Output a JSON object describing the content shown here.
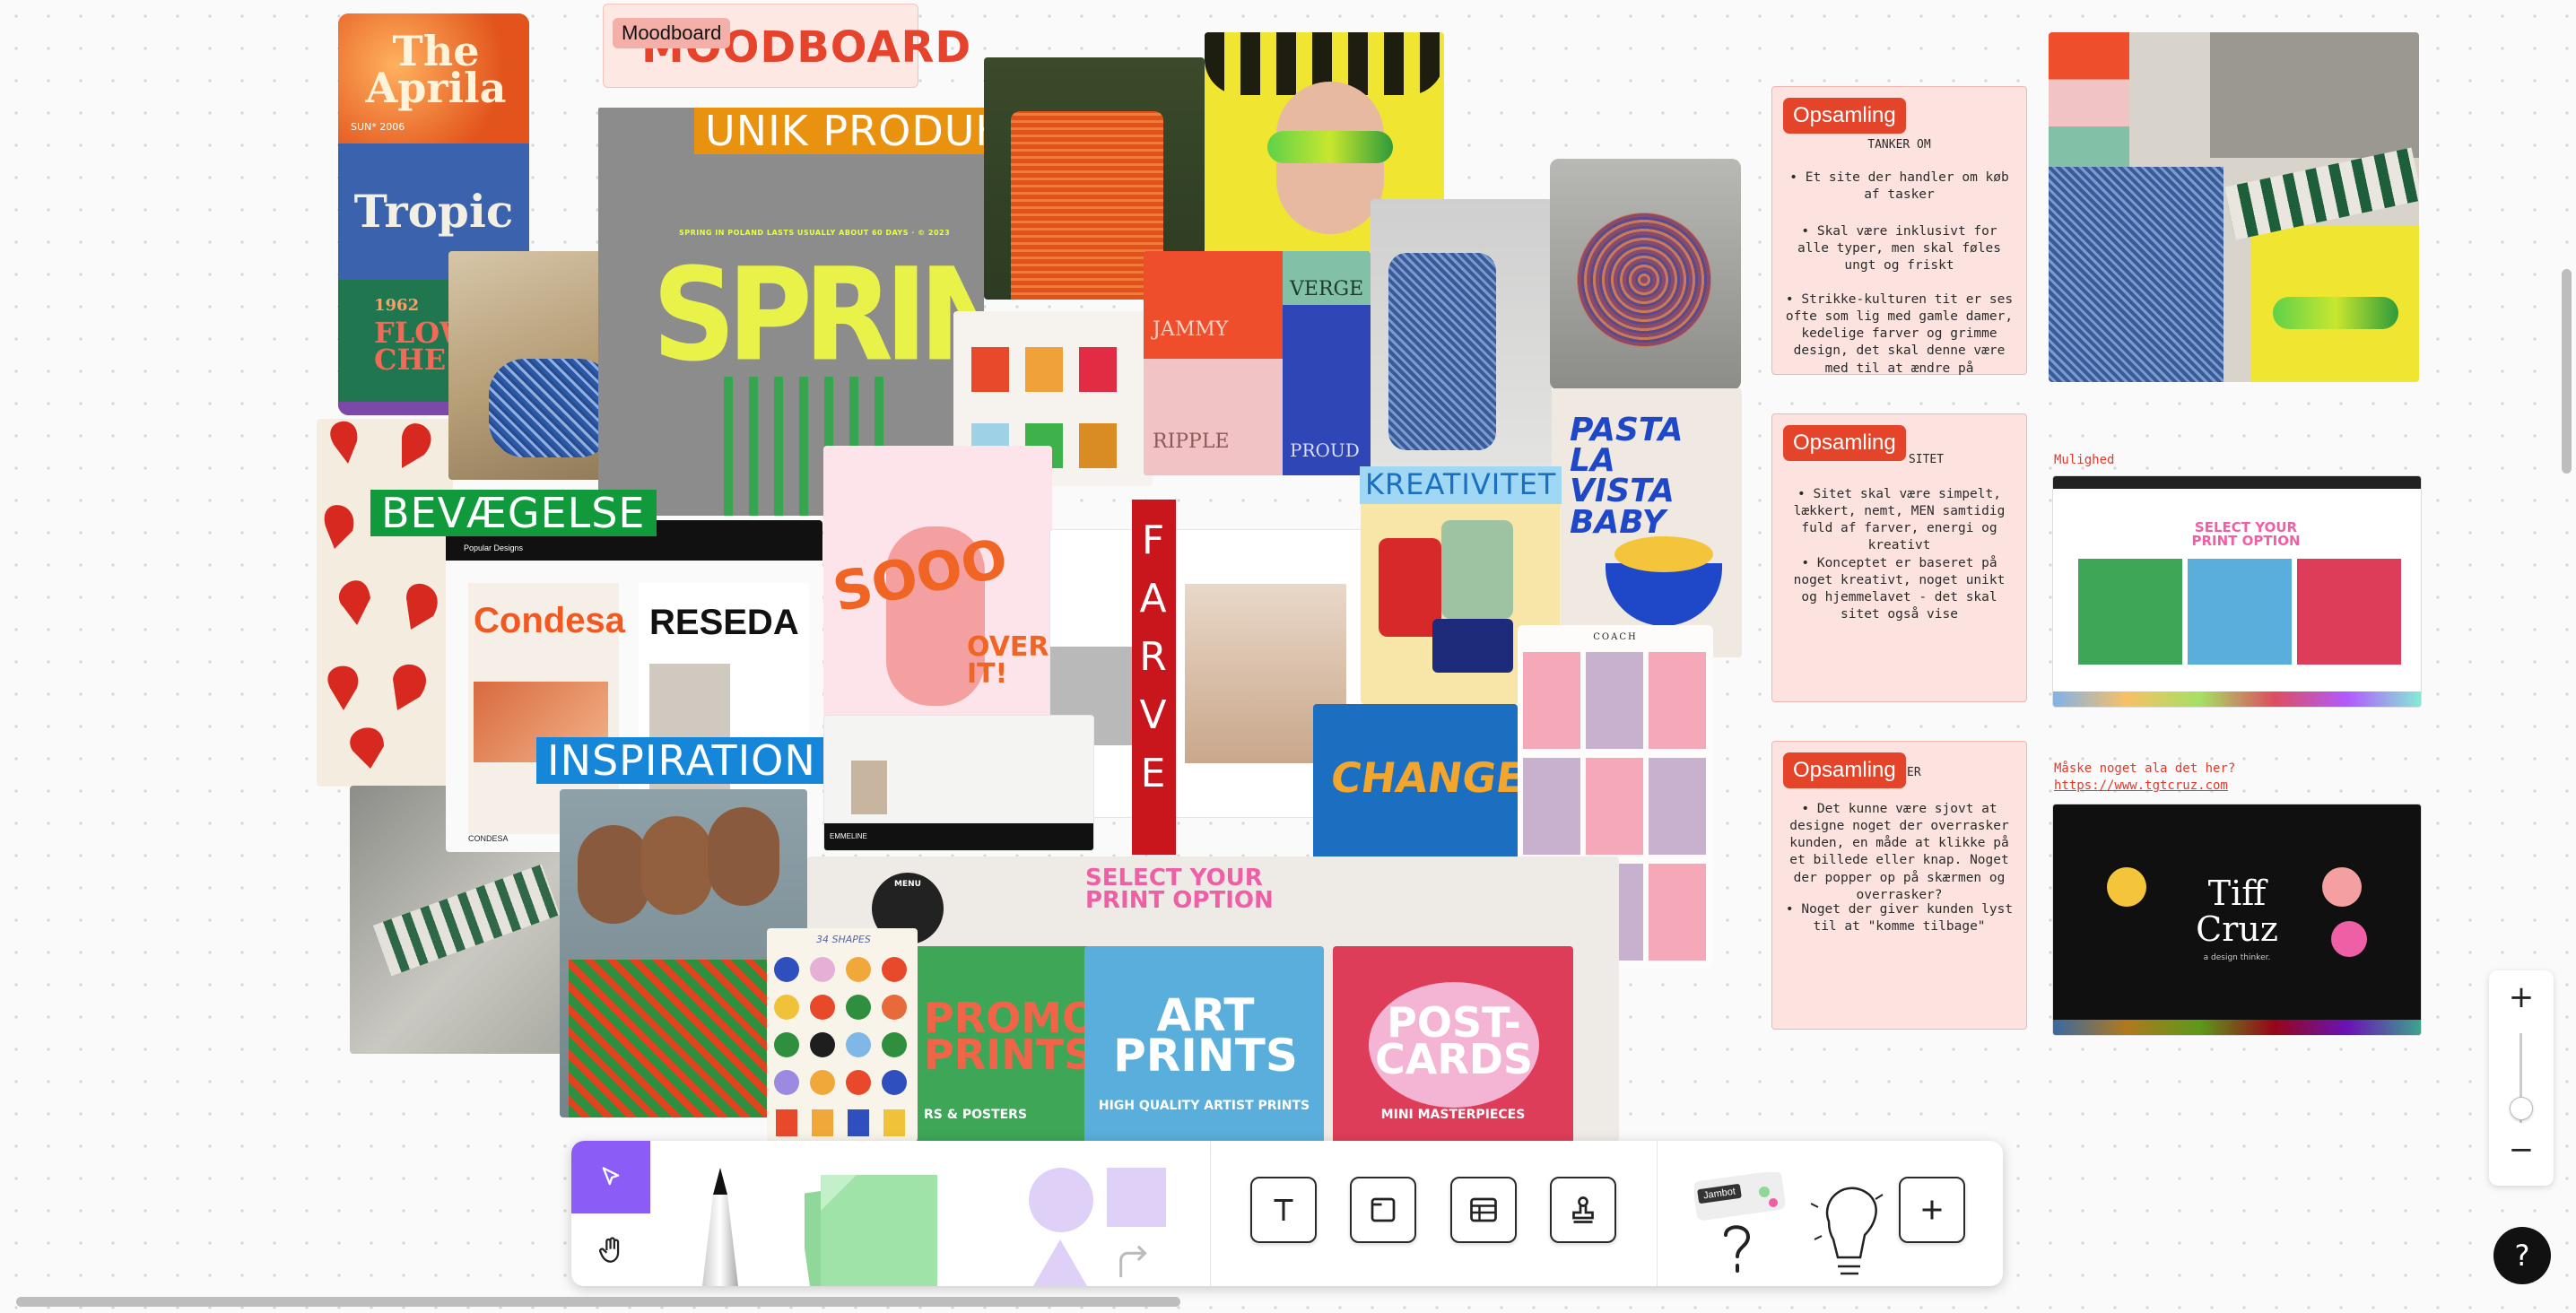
{
  "board": {
    "title_badge": "Moodboard",
    "title_big": "MOODBOARD",
    "labels": {
      "unik": "UNIK PRODUKT",
      "bevaegelse": "BEVÆGELSE",
      "inspiration": "INSPIRATION",
      "kreativitet": "KREATIVITET",
      "farve": "FARVE"
    }
  },
  "art_text": {
    "aprila": "The Aprila",
    "aprila_sub": "SUN* 2006",
    "tropic": "Tropic",
    "flow": "FLOW CHE",
    "flow_year": "1962",
    "spring": "SPRING",
    "spring_top": "SPRING IN POLAND LASTS USUALLY ABOUT 60 DAYS · © 2023",
    "popular": "Popular Designs",
    "condesa": "Condesa",
    "reseda": "RESEDA",
    "condesa_cap": "CONDESA",
    "emmeline": "EMMELINE",
    "sooo": "SOOO",
    "over_it": "OVER IT!",
    "verge": "VERGE",
    "jammy": "JAMMY",
    "ripple": "RIPPLE",
    "proud": "PROUD",
    "pasta": "PASTA LA VISTA BABY",
    "changes": "CHANGES",
    "coach": "COACH",
    "select_print": "SELECT YOUR PRINT OPTION",
    "menu": "MENU",
    "shapes": "34 SHAPES",
    "promo": "PROMO PRINTS",
    "promo_sub": "RS & POSTERS",
    "art": "ART PRINTS",
    "art_sub": "HIGH QUALITY ARTIST PRINTS",
    "post": "POST-CARDS",
    "post_sub": "MINI MASTERPIECES",
    "tiff": "Tiff Cruz",
    "tiff_sub": "a design thinker."
  },
  "notes": [
    {
      "tag": "Opsamling",
      "sub": "TANKER OM",
      "bullets": [
        "• Et site der handler om køb af tasker",
        "• Skal være inklusivt for alle typer, men skal føles ungt og friskt",
        "• Strikke-kulturen tit er ses ofte som lig med gamle damer, kedelige farver og grimme design, det skal denne være med til at ændre på"
      ]
    },
    {
      "tag": "Opsamling",
      "sub": "SITET",
      "bullets": [
        "• Sitet skal være simpelt, lækkert, nemt, MEN samtidig fuld af farver, energi og kreativt",
        "• Konceptet er baseret på noget kreativt, noget unikt og hjemmelavet - det skal sitet også vise"
      ]
    },
    {
      "tag": "Opsamling",
      "sub": "ER",
      "bullets": [
        "• Det kunne være sjovt at designe noget der overrasker kunden, en måde at klikke på et billede eller knap. Noget der popper op på skærmen og overrasker?",
        "• Noget der giver kunden lyst til at \"komme tilbage\""
      ]
    }
  ],
  "annotations": {
    "mulighed": "Mulighed",
    "maaske": "Måske noget ala det her?",
    "url": "https://www.tgtcruz.com"
  },
  "toolbar": {
    "sticker_badge": "Jambot"
  },
  "zoom": {
    "plus": "+",
    "minus": "−",
    "level": 0.45
  },
  "help": "?",
  "icons": [
    "pointer-icon",
    "hand-icon",
    "pen-icon",
    "sticky-note-icon",
    "shape-circle-icon",
    "shape-square-icon",
    "shape-triangle-icon",
    "connector-arrow-icon",
    "text-icon",
    "frame-icon",
    "table-icon",
    "stamp-icon",
    "sticker-icon",
    "idea-bulb-icon",
    "plus-icon"
  ],
  "colors": {
    "accent": "#8b5cf6",
    "note_tag": "#e4442a",
    "note_bg": "#fde3df"
  }
}
